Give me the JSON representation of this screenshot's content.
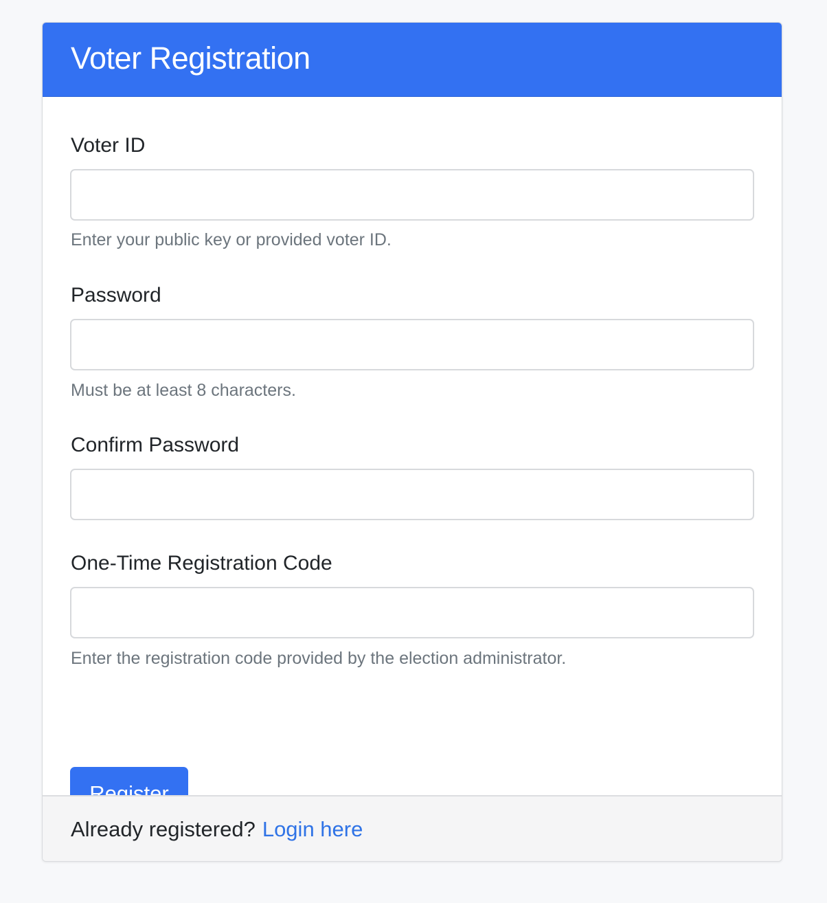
{
  "header": {
    "title": "Voter Registration"
  },
  "form": {
    "voter_id": {
      "label": "Voter ID",
      "value": "",
      "help": "Enter your public key or provided voter ID."
    },
    "password": {
      "label": "Password",
      "value": "",
      "help": "Must be at least 8 characters."
    },
    "confirm_password": {
      "label": "Confirm Password",
      "value": ""
    },
    "registration_code": {
      "label": "One-Time Registration Code",
      "value": "",
      "help": "Enter the registration code provided by the election administrator."
    },
    "submit_label": "Register"
  },
  "footer": {
    "prompt": "Already registered?",
    "link_label": "Login here"
  },
  "colors": {
    "primary": "#3371f2",
    "link": "#2f73e6",
    "help_text": "#6c757d",
    "page_background": "#f7f8fa"
  }
}
